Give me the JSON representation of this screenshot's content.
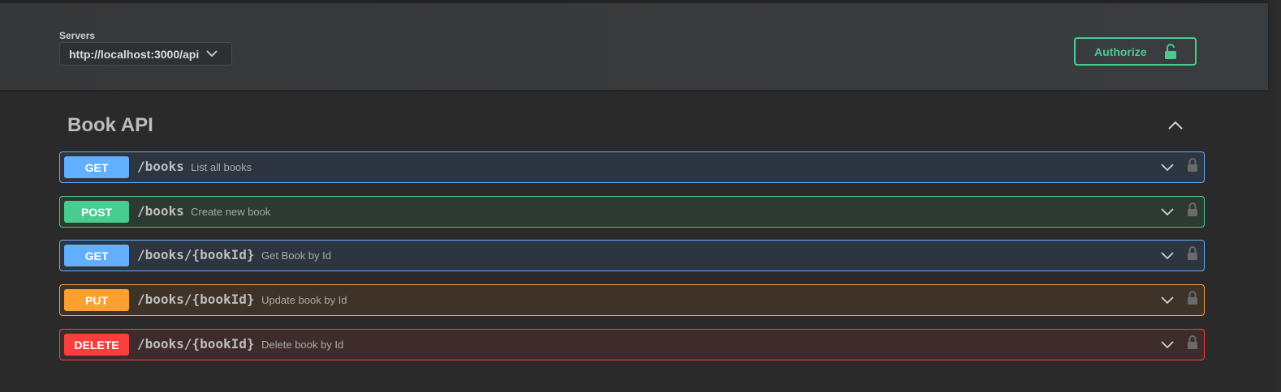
{
  "servers": {
    "label": "Servers",
    "selected": "http://localhost:3000/api"
  },
  "authorize": {
    "label": "Authorize",
    "icon": "unlocked-lock-icon",
    "color": "#49cc90"
  },
  "tag": {
    "title": "Book API",
    "state": "expanded"
  },
  "operations": [
    {
      "method": "GET",
      "path": "/books",
      "summary": "List all books",
      "color": "#61affe"
    },
    {
      "method": "POST",
      "path": "/books",
      "summary": "Create new book",
      "color": "#49cc90"
    },
    {
      "method": "GET",
      "path": "/books/{bookId}",
      "summary": "Get Book by Id",
      "color": "#61affe"
    },
    {
      "method": "PUT",
      "path": "/books/{bookId}",
      "summary": "Update book by Id",
      "color": "#fca130"
    },
    {
      "method": "DELETE",
      "path": "/books/{bookId}",
      "summary": "Delete book by Id",
      "color": "#f93e3e"
    }
  ]
}
